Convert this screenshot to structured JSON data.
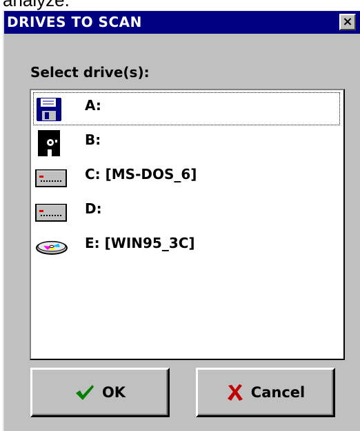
{
  "background_text": "analyze.",
  "dialog": {
    "title": "DRIVES TO SCAN",
    "close_glyph": "×"
  },
  "prompt_label": "Select drive(s):",
  "drives": [
    {
      "label": "A:",
      "icon": "floppy-3.5-icon"
    },
    {
      "label": "B:",
      "icon": "floppy-5.25-icon"
    },
    {
      "label": "C: [MS-DOS_6]",
      "icon": "hard-drive-icon"
    },
    {
      "label": "D:",
      "icon": "hard-drive-icon"
    },
    {
      "label": "E: [WIN95_3C]",
      "icon": "cd-rom-icon"
    }
  ],
  "buttons": {
    "ok_label": "OK",
    "cancel_label": "Cancel"
  },
  "colors": {
    "titlebar": "#000080",
    "face": "#c0c0c0",
    "ok_check": "#008000",
    "cancel_x": "#c00000"
  }
}
